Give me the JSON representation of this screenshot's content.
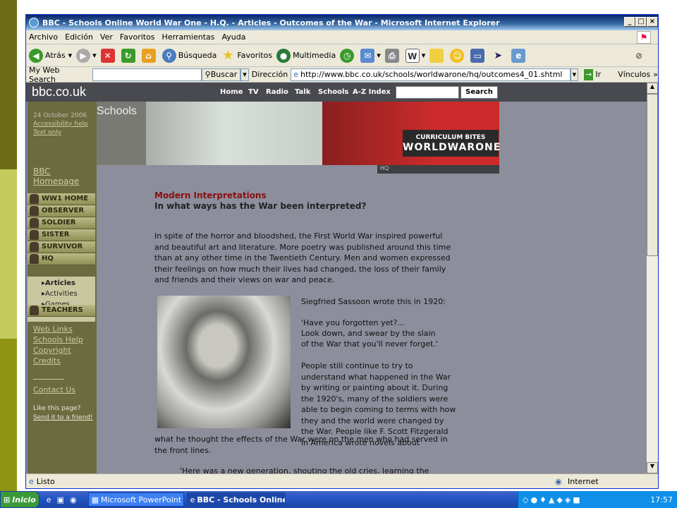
{
  "window": {
    "title": "BBC - Schools Online World War One - H.Q. - Articles - Outcomes of the War - Microsoft Internet Explorer"
  },
  "menu": [
    "Archivo",
    "Edición",
    "Ver",
    "Favoritos",
    "Herramientas",
    "Ayuda"
  ],
  "toolbar": {
    "back": "Atrás",
    "search": "Búsqueda",
    "favorites": "Favoritos",
    "multimedia": "Multimedia"
  },
  "addressbar": {
    "mywebsearch": "My Web Search",
    "buscar": "Buscar",
    "direccion": "Dirección",
    "url": "http://www.bbc.co.uk/schools/worldwarone/hq/outcomes4_01.shtml",
    "go": "Ir",
    "links": "Vínculos"
  },
  "site": {
    "logo": "bbc.co.uk",
    "nav": [
      "Home",
      "TV",
      "Radio",
      "Talk",
      "Schools",
      "A-Z Index"
    ],
    "search_button": "Search",
    "banner_title": "Schools",
    "curriculum": "CURRICULUM BITES",
    "wwlogo": "WORLDWARONE",
    "hq": "HQ",
    "date": "24 October 2006",
    "accessibility": "Accessibility help",
    "textonly": "Text only",
    "bbchome": "BBC Homepage",
    "sections": [
      "WW1 HOME",
      "OBSERVER",
      "SOLDIER",
      "SISTER",
      "SURVIVOR",
      "HQ"
    ],
    "hq_sub": [
      "Articles",
      "Activities",
      "Games"
    ],
    "teachers": "TEACHERS",
    "links": [
      "Web Links",
      "Schools Help",
      "Copyright",
      "Credits"
    ],
    "contact": "Contact Us",
    "like": "Like this page?",
    "send": "Send it to a friend!"
  },
  "article": {
    "heading": "Modern Interpretations",
    "subheading": "In what ways has the War been interpreted?",
    "p1": "In spite of the horror and bloodshed, the First World War inspired powerful and beautiful art and literature. More poetry was published around this time than at any other time in the Twentieth Century. Men and women expressed their feelings on how much their lives had changed, the loss of their family and friends and their views on war and peace.",
    "sassoon": "Siegfried Sassoon wrote this in 1920:",
    "quote": [
      "'Have you forgotten yet?...",
      "Look down, and swear by the slain",
      "of the War that you'll never forget.'"
    ],
    "p2": "People still continue to try to understand what happened in the War by writing or painting about it. During the 1920's, many of the soldiers were able to begin coming to terms with how they and the world were changed by the War. People like F. Scott Fitzgerald in America wrote novels about",
    "p2b": "what he thought the effects of the War were on the men who had served in the front lines.",
    "quote2": "'Here was a new generation, shouting the old cries, learning the old creeds, through a revery of long days and nights; destined finally to"
  },
  "status": {
    "left": "Listo",
    "zone": "Internet"
  },
  "taskbar": {
    "start": "Inicio",
    "tasks": [
      "Microsoft PowerPoint - [...",
      "BBC - Schools Online ..."
    ],
    "clock": "17:57"
  }
}
